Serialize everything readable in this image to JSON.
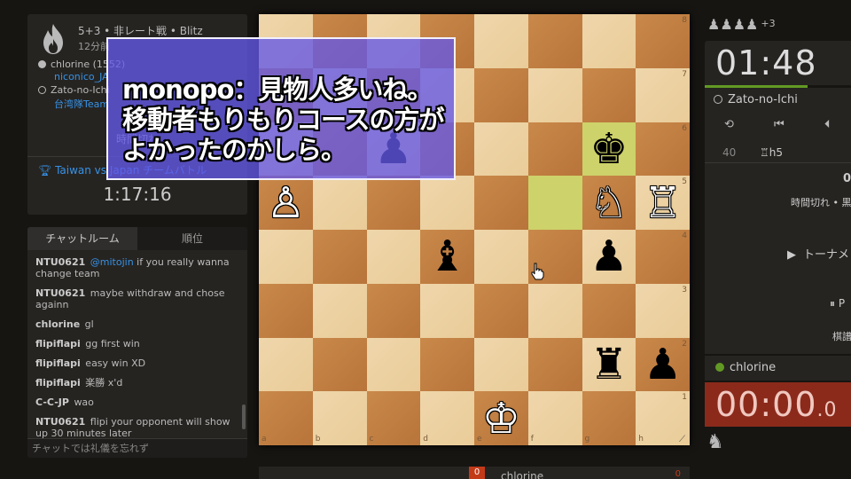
{
  "game": {
    "title": "5+3 • 非レート戦 • Blitz",
    "subtitle": "12分前",
    "white_player": "chlorine (1552)",
    "white_team": "niconico_JA",
    "black_player": "Zato-no-Ichi",
    "black_team": "台湾隊Team",
    "result": "時間切れ",
    "arena": "Taiwan vs Japan チームバトル",
    "arena_clock": "1:17:16"
  },
  "chat": {
    "tab_chat": "チャットルーム",
    "tab_rank": "順位",
    "messages": [
      {
        "user": "NTU0621",
        "mention": "@mitojin",
        "text": "if you really wanna change team"
      },
      {
        "user": "NTU0621",
        "mention": "",
        "text": "maybe withdraw and chose againn"
      },
      {
        "user": "chlorine",
        "mention": "",
        "text": "gl"
      },
      {
        "user": "flipiflapi",
        "mention": "",
        "text": "gg first win"
      },
      {
        "user": "flipiflapi",
        "mention": "",
        "text": "easy win XD"
      },
      {
        "user": "flipiflapi",
        "mention": "",
        "text": "楽勝 x'd"
      },
      {
        "user": "C-C-JP",
        "mention": "",
        "text": "wao"
      },
      {
        "user": "NTU0621",
        "mention": "",
        "text": "flipi your opponent will show up 30 minutes later"
      }
    ],
    "placeholder": "チャットでは礼儀を忘れず"
  },
  "subtitle": {
    "line1": "monopo：見物人多いね。",
    "line2": "移動者もりもりコースの方が",
    "line3": "よかったのかしら。"
  },
  "board": {
    "files": [
      "a",
      "b",
      "c",
      "d",
      "e",
      "f",
      "g",
      "h"
    ],
    "ranks": [
      "8",
      "7",
      "6",
      "5",
      "4",
      "3",
      "2",
      "1"
    ],
    "highlight": [
      "f5",
      "g6"
    ],
    "pieces": [
      {
        "square": "c6",
        "piece": "♟",
        "color": "b",
        "name": "black-pawn-icon"
      },
      {
        "square": "g6",
        "piece": "♚",
        "color": "b",
        "name": "black-king-icon"
      },
      {
        "square": "a5",
        "piece": "♙",
        "color": "w",
        "name": "white-pawn-icon"
      },
      {
        "square": "g5",
        "piece": "♘",
        "color": "w",
        "name": "white-knight-icon"
      },
      {
        "square": "h5",
        "piece": "♖",
        "color": "w",
        "name": "white-rook-icon"
      },
      {
        "square": "d4",
        "piece": "♝",
        "color": "b",
        "name": "black-bishop-icon"
      },
      {
        "square": "g4",
        "piece": "♟",
        "color": "b",
        "name": "black-pawn-icon"
      },
      {
        "square": "g2",
        "piece": "♜",
        "color": "b",
        "name": "black-rook-icon"
      },
      {
        "square": "h2",
        "piece": "♟",
        "color": "b",
        "name": "black-pawn-icon"
      },
      {
        "square": "e1",
        "piece": "♔",
        "color": "w",
        "name": "white-king-icon"
      }
    ]
  },
  "bottom_bar": {
    "score": "0",
    "name": "chlorine",
    "right": "0"
  },
  "right_panel": {
    "captured": "♟♟♟♟",
    "captured_plus": "+3",
    "top_clock": "01:48",
    "top_player": "Zato-no-Ichi",
    "controls": [
      "⟲",
      "⏮",
      "⏴"
    ],
    "move_number": "40",
    "move_san": "♖h5",
    "result_score": "0",
    "result_text": "時間切れ • 黒",
    "tournament_button": "トーナメ",
    "pause": "⏸ P",
    "kifu": "棋譜",
    "bottom_player": "chlorine",
    "bottom_clock": "00:00",
    "bottom_clock_tenths": ".0"
  },
  "colors": {
    "background": "#161512",
    "panel": "#262421",
    "link": "#3692e7",
    "subtitle_box": "#6458e8",
    "clock_low": "#8b2a1b",
    "online": "#629924"
  }
}
